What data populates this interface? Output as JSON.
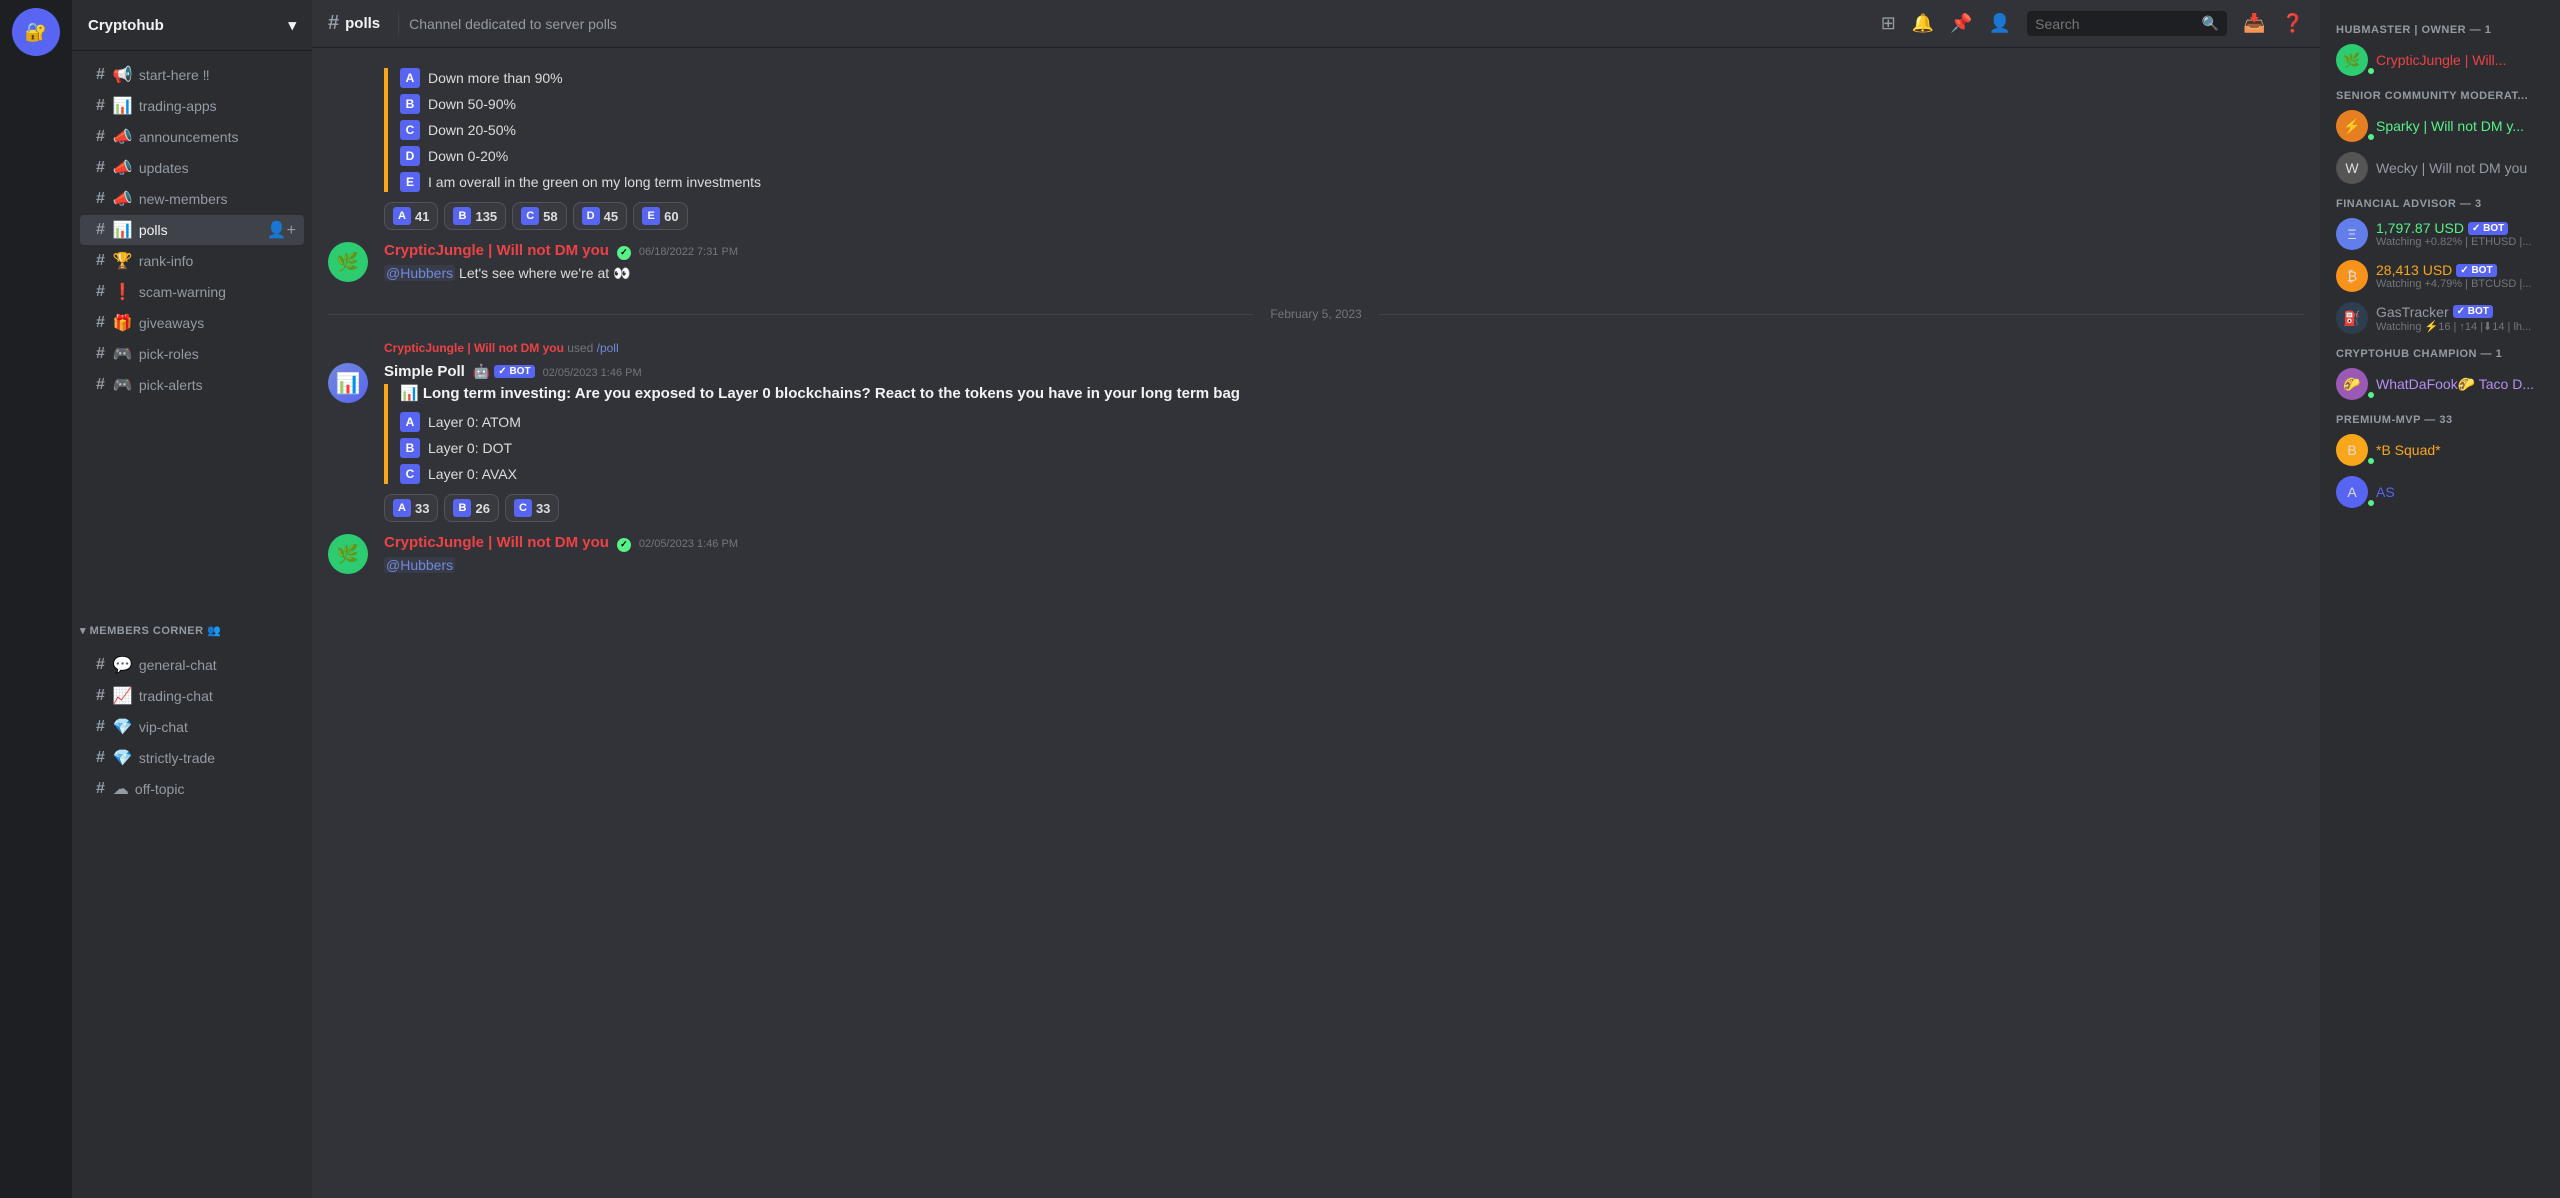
{
  "server": {
    "name": "Cryptohub",
    "icon": "🔐"
  },
  "header": {
    "channel_icon": "#",
    "channel_name": "polls",
    "description": "Channel dedicated to server polls",
    "search_placeholder": "Search"
  },
  "sidebar": {
    "channels_top": [
      {
        "id": "start-here",
        "label": "start-here ‼",
        "icon": "📢"
      },
      {
        "id": "trading-apps",
        "label": "trading-apps",
        "icon": "📊"
      },
      {
        "id": "announcements",
        "label": "announcements",
        "icon": "📣"
      },
      {
        "id": "updates",
        "label": "updates",
        "icon": "📣"
      },
      {
        "id": "new-members",
        "label": "new-members",
        "icon": "📣"
      },
      {
        "id": "polls",
        "label": "polls",
        "icon": "📊",
        "active": true
      },
      {
        "id": "rank-info",
        "label": "rank-info",
        "icon": "🏆"
      },
      {
        "id": "scam-warning",
        "label": "scam-warning",
        "icon": "❗"
      },
      {
        "id": "giveaways",
        "label": "giveaways",
        "icon": "🎁"
      },
      {
        "id": "pick-roles",
        "label": "pick-roles",
        "icon": "🎮"
      },
      {
        "id": "pick-alerts",
        "label": "pick-alerts",
        "icon": "🎮"
      }
    ],
    "members_corner_category": "MEMBERS CORNER 👥",
    "channels_members": [
      {
        "id": "general-chat",
        "label": "general-chat",
        "icon": "💬"
      },
      {
        "id": "trading-chat",
        "label": "trading-chat",
        "icon": "📈"
      },
      {
        "id": "vip-chat",
        "label": "vip-chat",
        "icon": "💎"
      },
      {
        "id": "strictly-trade",
        "label": "strictly-trade",
        "icon": "💎"
      },
      {
        "id": "off-topic",
        "label": "off-topic",
        "icon": "☁"
      }
    ]
  },
  "messages": {
    "poll1": {
      "options": [
        {
          "letter": "A",
          "text": "Down more than 90%"
        },
        {
          "letter": "B",
          "text": "Down 50-90%"
        },
        {
          "letter": "C",
          "text": "Down 20-50%"
        },
        {
          "letter": "D",
          "text": "Down 0-20%"
        },
        {
          "letter": "E",
          "text": "I am overall in the green on my long term investments"
        }
      ],
      "reactions": [
        {
          "letter": "A",
          "count": "41"
        },
        {
          "letter": "B",
          "count": "135"
        },
        {
          "letter": "C",
          "count": "58"
        },
        {
          "letter": "D",
          "count": "45"
        },
        {
          "letter": "E",
          "count": "60"
        }
      ]
    },
    "msg1": {
      "author": "CrypticJungle | Will not DM you",
      "verified": true,
      "timestamp": "06/18/2022 7:31 PM",
      "content": "@Hubbers Let's see where we're at 👀"
    },
    "date_sep": "February 5, 2023",
    "used_notice": {
      "author": "CrypticJungle | Will not DM you",
      "command": "/poll"
    },
    "poll2": {
      "bot_name": "Simple Poll",
      "bot_timestamp": "02/05/2023 1:46 PM",
      "title": "📊 Long term investing: Are you exposed to Layer 0 blockchains? React to the tokens you have in your long term bag",
      "options": [
        {
          "letter": "A",
          "text": "Layer 0: ATOM"
        },
        {
          "letter": "B",
          "text": "Layer 0: DOT"
        },
        {
          "letter": "C",
          "text": "Layer 0: AVAX"
        }
      ],
      "reactions": [
        {
          "letter": "A",
          "count": "33"
        },
        {
          "letter": "B",
          "count": "26"
        },
        {
          "letter": "C",
          "count": "33"
        }
      ]
    },
    "msg2": {
      "author": "CrypticJungle | Will not DM you",
      "verified": true,
      "timestamp": "02/05/2023 1:46 PM",
      "content": "@Hubbers"
    }
  },
  "right_panel": {
    "sections": [
      {
        "title": "HUBMASTER | OWNER — 1",
        "members": [
          {
            "name": "CrypticJungle | Will...",
            "color": "red",
            "avatar_color": "av-cj",
            "avatar_text": "🌿",
            "online": true,
            "sub": ""
          }
        ]
      },
      {
        "title": "SENIOR COMMUNITY MODERAT...",
        "members": [
          {
            "name": "Sparky | Will not DM y...",
            "color": "green",
            "avatar_color": "av-sparky",
            "avatar_text": "⚡",
            "online": true,
            "sub": ""
          },
          {
            "name": "Wecky | Will not DM you",
            "color": "gray",
            "avatar_color": "av-wecky",
            "avatar_text": "W",
            "online": false,
            "sub": ""
          }
        ]
      },
      {
        "title": "FINANCIAL ADVISOR — 3",
        "members": [
          {
            "name": "1,797.87 USD",
            "color": "green",
            "avatar_color": "av-eth",
            "avatar_text": "Ξ",
            "online": false,
            "sub": "Watching +0.82% | ETHUSD |...",
            "badges": [
              "BOT"
            ]
          },
          {
            "name": "28,413 USD",
            "color": "yellow",
            "avatar_color": "av-btc",
            "avatar_text": "₿",
            "online": false,
            "sub": "Watching +4.79% | BTCUSD |...",
            "badges": [
              "BOT"
            ]
          },
          {
            "name": "GasTracker",
            "color": "gray",
            "avatar_color": "av-gas",
            "avatar_text": "⛽",
            "online": false,
            "sub": "Watching ⚡16 | ↑14 |⬇14 | lh...",
            "badges": [
              "BOT"
            ]
          }
        ]
      },
      {
        "title": "CRYPTOHUB CHAMPION — 1",
        "members": [
          {
            "name": "WhatDaFook🌮 Taco D...",
            "color": "purple",
            "avatar_color": "av-wdtd",
            "avatar_text": "🌮",
            "online": true,
            "sub": ""
          }
        ]
      },
      {
        "title": "PREMIUM-MVP — 33",
        "members": [
          {
            "name": "*B Squad*",
            "color": "yellow",
            "avatar_color": "av-gold",
            "avatar_text": "B",
            "online": true,
            "sub": ""
          },
          {
            "name": "AS",
            "color": "blue",
            "avatar_color": "av-dc",
            "avatar_text": "A",
            "online": true,
            "sub": ""
          }
        ]
      }
    ]
  }
}
